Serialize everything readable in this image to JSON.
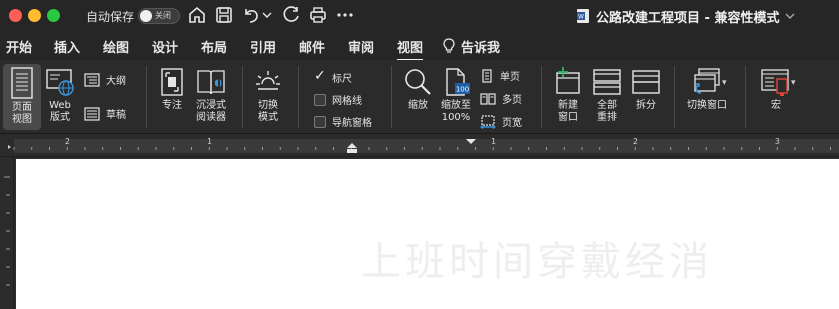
{
  "titlebar": {
    "autosave_label": "自动保存",
    "autosave_state": "关闭",
    "document_title": "公路改建工程项目 - 兼容性模式",
    "icons": [
      "home-icon",
      "save-icon",
      "undo-icon",
      "redo-icon",
      "print-icon",
      "more-icon"
    ]
  },
  "menu": {
    "tabs": [
      "开始",
      "插入",
      "绘图",
      "设计",
      "布局",
      "引用",
      "邮件",
      "审阅",
      "视图",
      "告诉我"
    ],
    "active": "视图"
  },
  "ribbon": {
    "page_view": "页面\n视图",
    "web_layout": "Web\n版式",
    "outline": "大纲",
    "draft": "草稿",
    "focus": "专注",
    "immersive_reader": "沉浸式\n阅读器",
    "switch_mode": "切换\n模式",
    "ruler": "标尺",
    "gridlines": "网格线",
    "nav_pane": "导航窗格",
    "zoom": "缩放",
    "zoom_100": "缩放至\n100%",
    "zoom_100_badge": "100",
    "one_page": "单页",
    "multi_page": "多页",
    "page_width": "页宽",
    "new_window": "新建\n窗口",
    "arrange_all": "全部\n重排",
    "split": "拆分",
    "switch_window": "切换窗口",
    "macros": "宏"
  },
  "ruler": {
    "numbers": [
      "2",
      "1",
      "1",
      "2",
      "3"
    ]
  },
  "document": {
    "watermark": "上班时间穿戴经消"
  }
}
